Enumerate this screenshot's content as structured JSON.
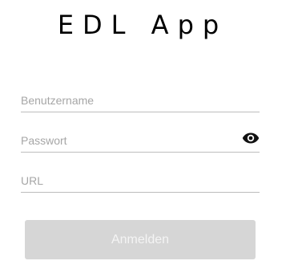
{
  "app": {
    "title": "EDL App"
  },
  "form": {
    "username": {
      "placeholder": "Benutzername",
      "value": ""
    },
    "password": {
      "placeholder": "Passwort",
      "value": "",
      "toggle_icon": "eye-icon"
    },
    "url": {
      "placeholder": "URL",
      "value": ""
    },
    "login_label": "Anmelden"
  },
  "colors": {
    "button_disabled_bg": "#d6d6d6",
    "button_disabled_text": "#f4f4f4",
    "underline": "#bdbdbd",
    "placeholder": "#a6a6a6"
  }
}
